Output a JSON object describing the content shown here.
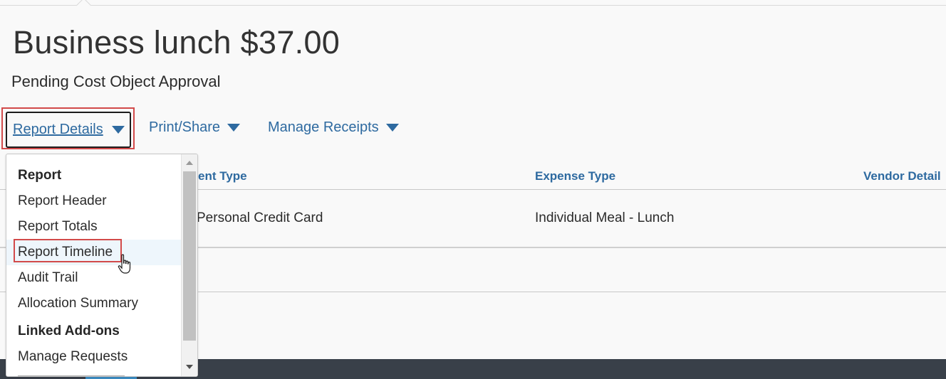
{
  "header": {
    "title": "Business lunch $37.00",
    "status": "Pending Cost Object Approval"
  },
  "toolbar": {
    "report_details": "Report Details",
    "print_share": "Print/Share",
    "manage_receipts": "Manage Receipts"
  },
  "table": {
    "columns": [
      "ent Type",
      "Expense Type",
      "Vendor Detail"
    ],
    "rows": [
      {
        "payment_type": "Personal Credit Card",
        "expense_type": "Individual Meal - Lunch"
      }
    ]
  },
  "menu": {
    "items": [
      {
        "label": "Report",
        "heading": true
      },
      {
        "label": "Report Header"
      },
      {
        "label": "Report Totals"
      },
      {
        "label": "Report Timeline",
        "highlighted": true
      },
      {
        "label": "Audit Trail"
      },
      {
        "label": "Allocation Summary"
      },
      {
        "label": "Linked Add-ons",
        "heading": true
      },
      {
        "label": "Manage Requests"
      }
    ]
  },
  "colors": {
    "link": "#2e6aa0",
    "highlight_border": "#d24a4a",
    "footer": "#394049"
  },
  "icons": [
    "caret-down-icon",
    "hand-cursor-icon",
    "scroll-up-arrow",
    "scroll-down-arrow"
  ]
}
